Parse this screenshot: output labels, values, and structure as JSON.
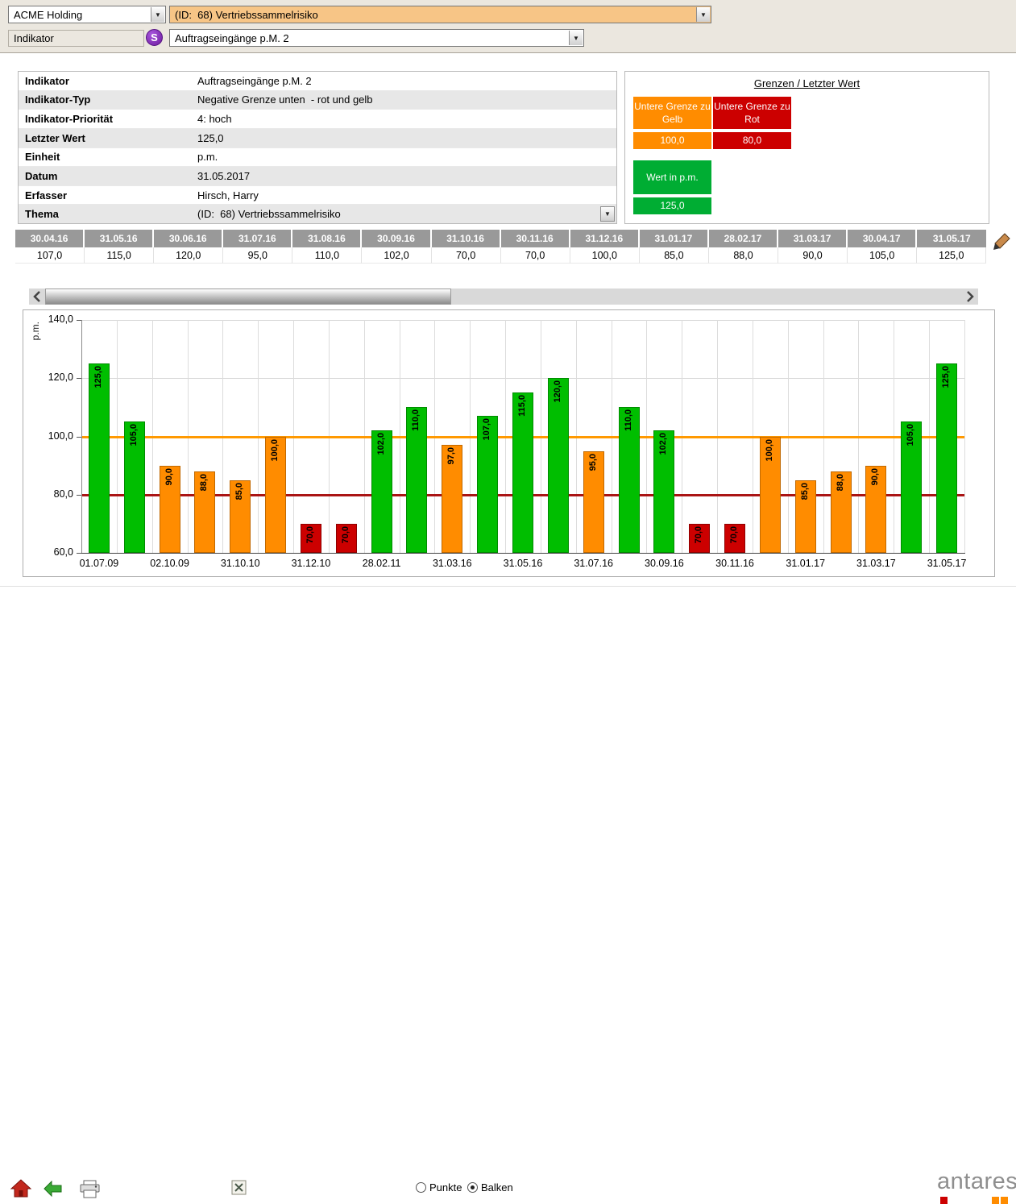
{
  "topbar": {
    "company": "ACME Holding",
    "risk": "(ID:  68) Vertriebssammelrisiko",
    "indicator_label": "Indikator",
    "s_badge": "S",
    "indicator": "Auftragseingänge p.M. 2"
  },
  "info": {
    "rows": [
      {
        "label": "Indikator",
        "value": "Auftragseingänge p.M. 2"
      },
      {
        "label": "Indikator-Typ",
        "value": "Negative Grenze unten  - rot und gelb"
      },
      {
        "label": "Indikator-Priorität",
        "value": "4: hoch"
      },
      {
        "label": "Letzter Wert",
        "value": "125,0"
      },
      {
        "label": "Einheit",
        "value": "p.m."
      },
      {
        "label": "Datum",
        "value": "31.05.2017"
      },
      {
        "label": "Erfasser",
        "value": "Hirsch, Harry"
      },
      {
        "label": "Thema",
        "value": "(ID:  68) Vertriebssammelrisiko",
        "has_dropdown": true
      }
    ]
  },
  "limits": {
    "title": "Grenzen / Letzter Wert",
    "yellow": {
      "label": "Untere Grenze zu Gelb",
      "value": "100,0",
      "color": "#FF8C00"
    },
    "red": {
      "label": "Untere Grenze zu Rot",
      "value": "80,0",
      "color": "#CC0000"
    },
    "current": {
      "label": "Wert in p.m.",
      "value": "125,0",
      "color": "#00AD33"
    }
  },
  "history": {
    "columns": [
      {
        "date": "30.04.16",
        "value": "107,0"
      },
      {
        "date": "31.05.16",
        "value": "115,0"
      },
      {
        "date": "30.06.16",
        "value": "120,0"
      },
      {
        "date": "31.07.16",
        "value": "95,0"
      },
      {
        "date": "31.08.16",
        "value": "110,0"
      },
      {
        "date": "30.09.16",
        "value": "102,0"
      },
      {
        "date": "31.10.16",
        "value": "70,0"
      },
      {
        "date": "30.11.16",
        "value": "70,0"
      },
      {
        "date": "31.12.16",
        "value": "100,0"
      },
      {
        "date": "31.01.17",
        "value": "85,0"
      },
      {
        "date": "28.02.17",
        "value": "88,0"
      },
      {
        "date": "31.03.17",
        "value": "90,0"
      },
      {
        "date": "30.04.17",
        "value": "105,0"
      },
      {
        "date": "31.05.17",
        "value": "125,0"
      }
    ]
  },
  "chart_data": {
    "type": "bar",
    "ylabel": "p.m.",
    "ylim": [
      60,
      140
    ],
    "yticks": [
      140,
      120,
      100,
      80,
      60
    ],
    "ytick_labels": [
      "140,0",
      "120,0",
      "100,0",
      "80,0",
      "60,0"
    ],
    "grid": true,
    "legend": "none",
    "limit_lines": [
      {
        "value": 100,
        "color": "#FF9900",
        "name": "Untere Grenze zu Gelb"
      },
      {
        "value": 80,
        "color": "#AA1414",
        "name": "Untere Grenze zu Rot"
      }
    ],
    "colors": {
      "green": "#00BE00",
      "orange": "#FF8C00",
      "red": "#CC0000"
    },
    "bars": [
      {
        "value": 125.0,
        "label": "125,0",
        "status": "green",
        "x_label": "01.07.09"
      },
      {
        "value": 105.0,
        "label": "105,0",
        "status": "green"
      },
      {
        "value": 90.0,
        "label": "90,0",
        "status": "orange",
        "x_label": "02.10.09"
      },
      {
        "value": 88.0,
        "label": "88,0",
        "status": "orange"
      },
      {
        "value": 85.0,
        "label": "85,0",
        "status": "orange",
        "x_label": "31.10.10"
      },
      {
        "value": 100.0,
        "label": "100,0",
        "status": "orange"
      },
      {
        "value": 70.0,
        "label": "70,0",
        "status": "red",
        "x_label": "31.12.10"
      },
      {
        "value": 70.0,
        "label": "70,0",
        "status": "red"
      },
      {
        "value": 102.0,
        "label": "102,0",
        "status": "green",
        "x_label": "28.02.11"
      },
      {
        "value": 110.0,
        "label": "110,0",
        "status": "green"
      },
      {
        "value": 97.0,
        "label": "97,0",
        "status": "orange",
        "x_label": "31.03.16"
      },
      {
        "value": 107.0,
        "label": "107,0",
        "status": "green"
      },
      {
        "value": 115.0,
        "label": "115,0",
        "status": "green",
        "x_label": "31.05.16"
      },
      {
        "value": 120.0,
        "label": "120,0",
        "status": "green"
      },
      {
        "value": 95.0,
        "label": "95,0",
        "status": "orange",
        "x_label": "31.07.16"
      },
      {
        "value": 110.0,
        "label": "110,0",
        "status": "green"
      },
      {
        "value": 102.0,
        "label": "102,0",
        "status": "green",
        "x_label": "30.09.16"
      },
      {
        "value": 70.0,
        "label": "70,0",
        "status": "red"
      },
      {
        "value": 70.0,
        "label": "70,0",
        "status": "red",
        "x_label": "30.11.16"
      },
      {
        "value": 100.0,
        "label": "100,0",
        "status": "orange"
      },
      {
        "value": 85.0,
        "label": "85,0",
        "status": "orange",
        "x_label": "31.01.17"
      },
      {
        "value": 88.0,
        "label": "88,0",
        "status": "orange"
      },
      {
        "value": 90.0,
        "label": "90,0",
        "status": "orange",
        "x_label": "31.03.17"
      },
      {
        "value": 105.0,
        "label": "105,0",
        "status": "green"
      },
      {
        "value": 125.0,
        "label": "125,0",
        "status": "green",
        "x_label": "31.05.17"
      }
    ]
  },
  "toolbar": {
    "radio_points": "Punkte",
    "radio_bars": "Balken",
    "selected": "Balken"
  },
  "logo": {
    "text": "antares",
    "squares": [
      "#CC0000",
      "#FF8C00",
      "#FF8C00"
    ]
  }
}
